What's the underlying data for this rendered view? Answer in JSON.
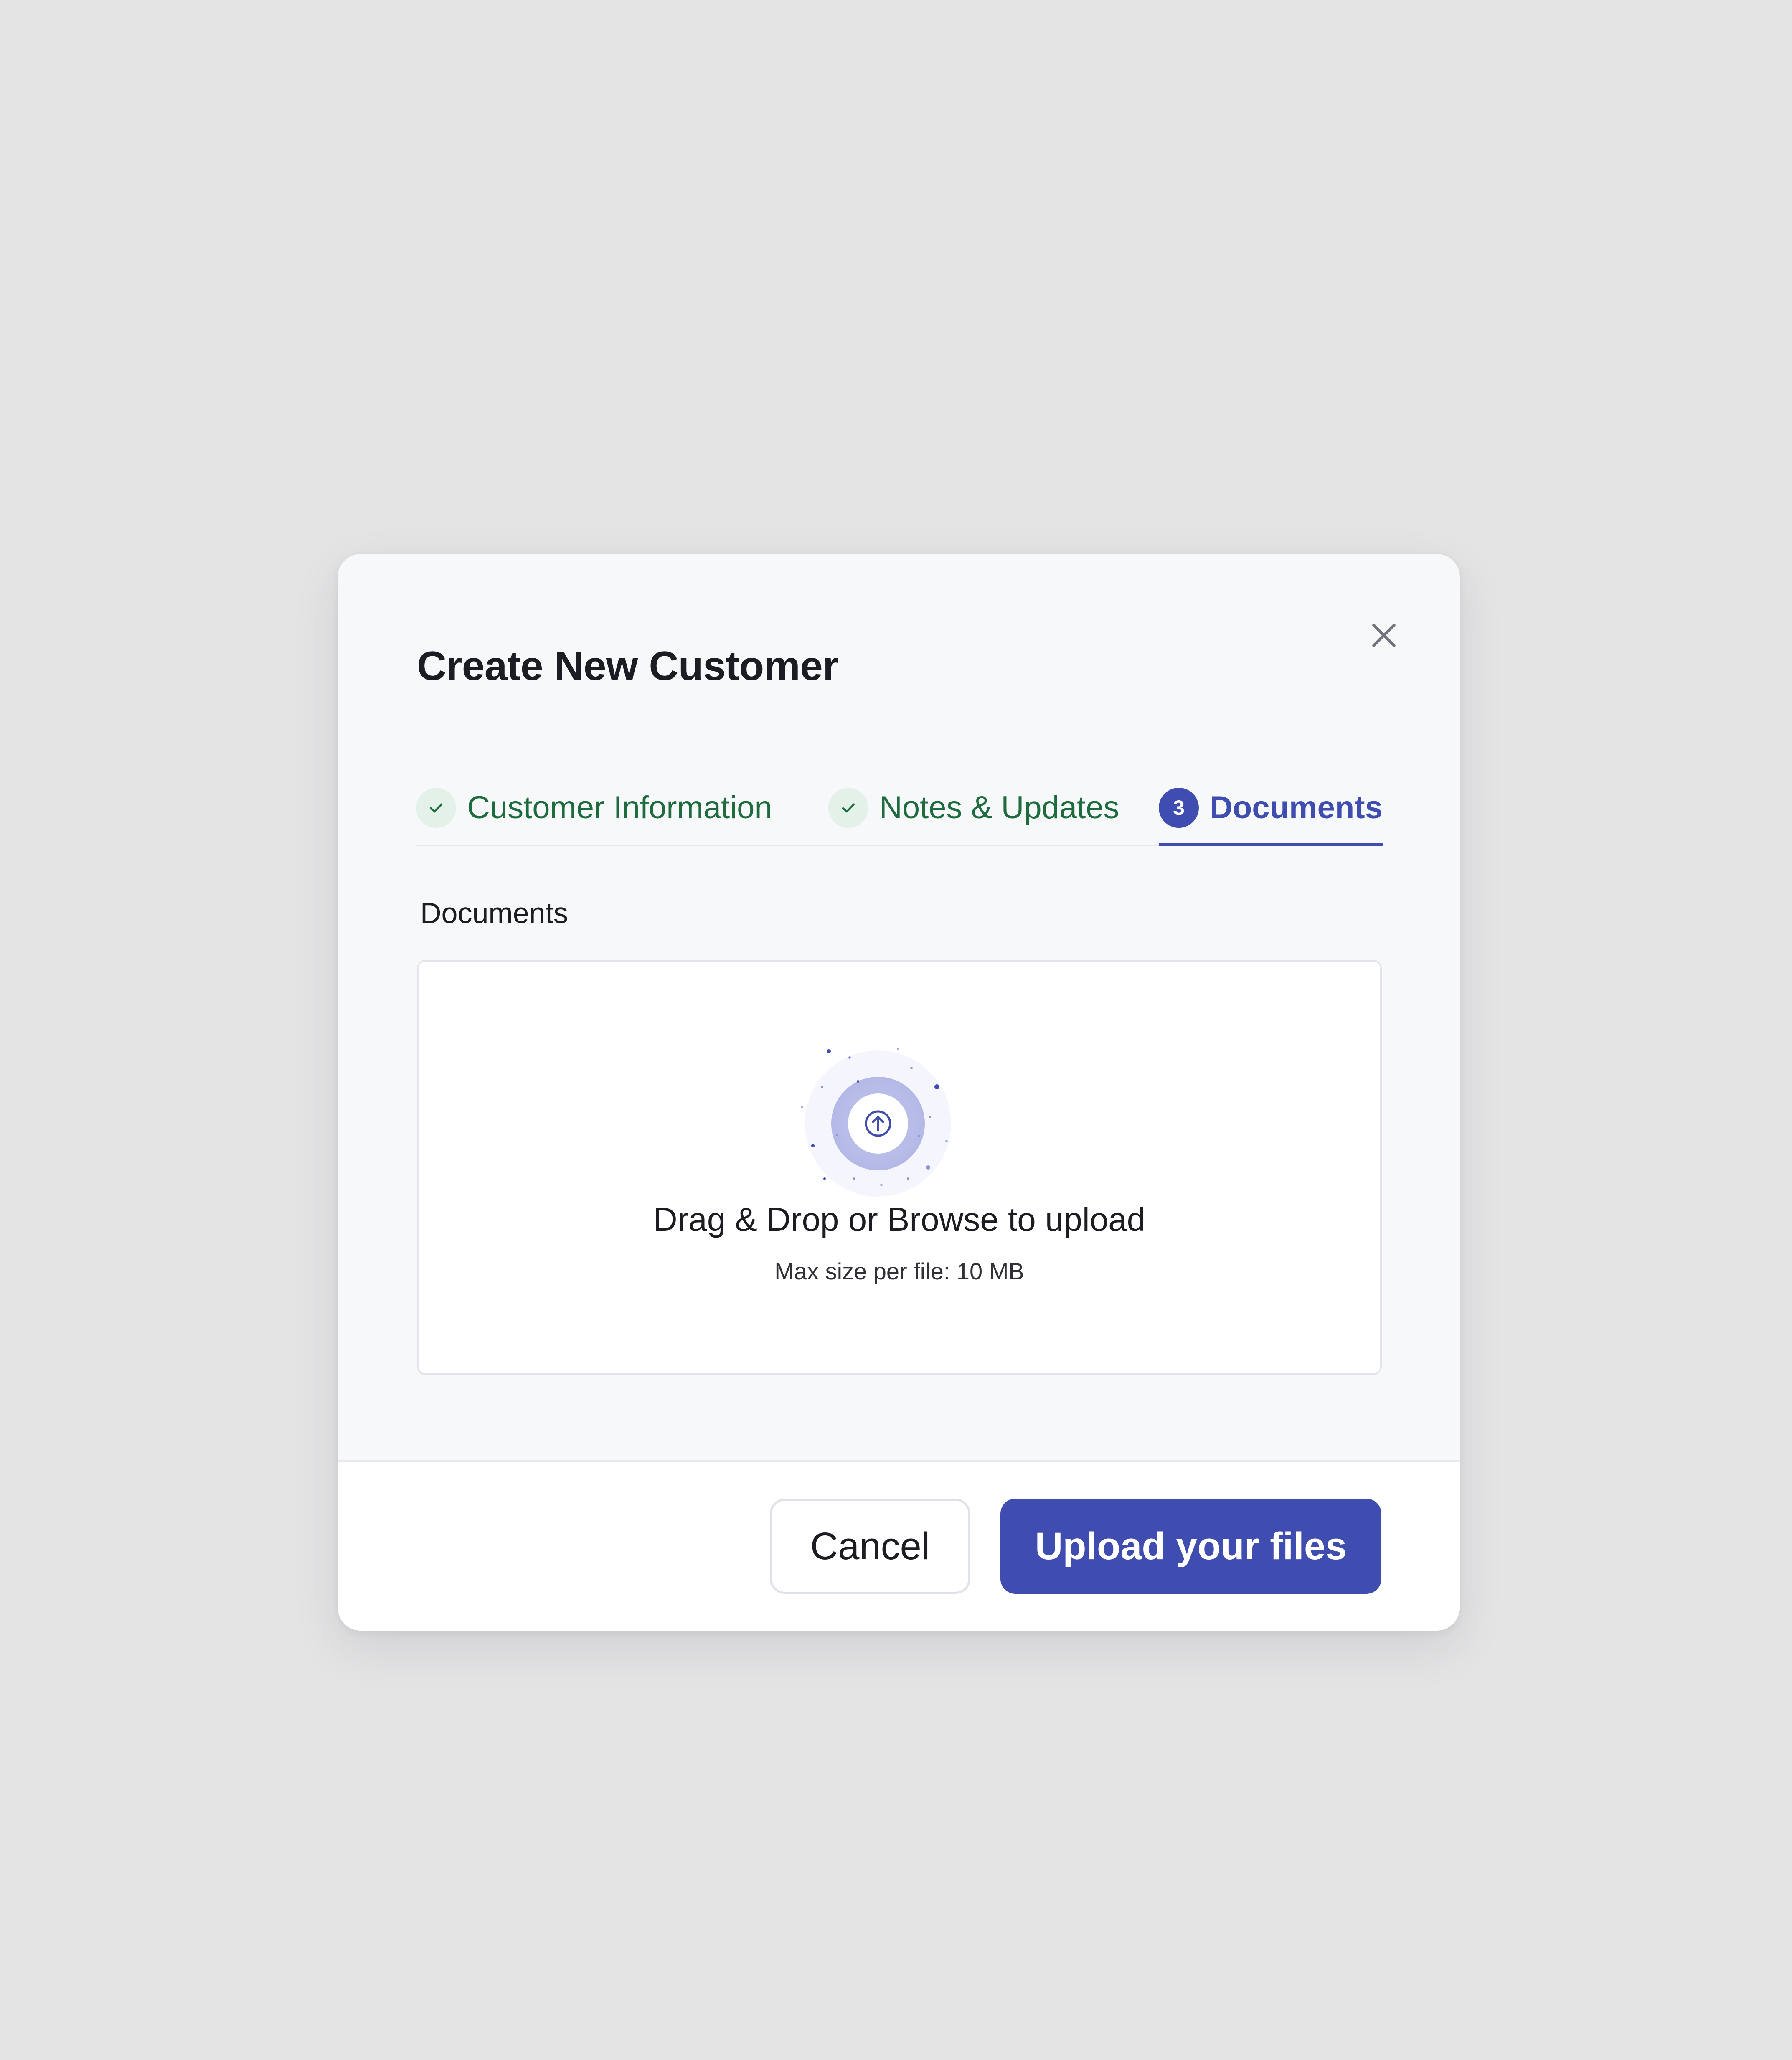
{
  "modal": {
    "title": "Create New Customer",
    "close_icon": "close-icon"
  },
  "stepper": {
    "steps": [
      {
        "label": "Customer Information",
        "status": "completed",
        "icon": "check-icon"
      },
      {
        "label": "Notes & Updates",
        "status": "completed",
        "icon": "check-icon"
      },
      {
        "label": "Documents",
        "status": "active",
        "number": "3"
      }
    ]
  },
  "documents": {
    "section_label": "Documents",
    "dropzone": {
      "icon": "upload-arrow-icon",
      "title": "Drag & Drop or Browse to upload",
      "subtitle": "Max size per file: 10 MB"
    }
  },
  "footer": {
    "cancel_label": "Cancel",
    "submit_label": "Upload your files"
  },
  "colors": {
    "accent": "#3f4db0",
    "success": "#1e6b3e",
    "success_bg": "#e3f1e8",
    "page_bg": "#e4e4e5",
    "modal_bg": "#f7f8fa"
  }
}
